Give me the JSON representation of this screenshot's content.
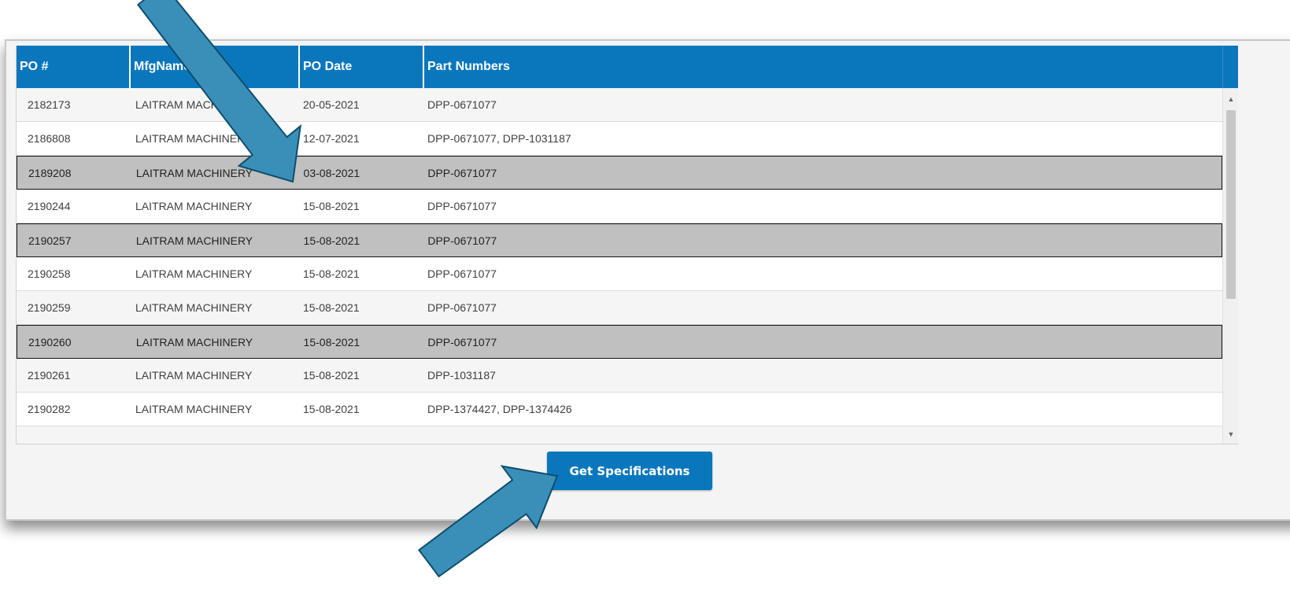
{
  "table": {
    "headers": [
      "PO #",
      "MfgName",
      "PO Date",
      "Part Numbers"
    ],
    "rows": [
      {
        "po": "2182173",
        "mfg": "LAITRAM MACHINERY",
        "date": "20-05-2021",
        "parts": "DPP-0671077",
        "selected": false
      },
      {
        "po": "2186808",
        "mfg": "LAITRAM MACHINERY",
        "date": "12-07-2021",
        "parts": "DPP-0671077, DPP-1031187",
        "selected": false
      },
      {
        "po": "2189208",
        "mfg": "LAITRAM MACHINERY",
        "date": "03-08-2021",
        "parts": "DPP-0671077",
        "selected": true
      },
      {
        "po": "2190244",
        "mfg": "LAITRAM MACHINERY",
        "date": "15-08-2021",
        "parts": "DPP-0671077",
        "selected": false
      },
      {
        "po": "2190257",
        "mfg": "LAITRAM MACHINERY",
        "date": "15-08-2021",
        "parts": "DPP-0671077",
        "selected": true
      },
      {
        "po": "2190258",
        "mfg": "LAITRAM MACHINERY",
        "date": "15-08-2021",
        "parts": "DPP-0671077",
        "selected": false
      },
      {
        "po": "2190259",
        "mfg": "LAITRAM MACHINERY",
        "date": "15-08-2021",
        "parts": "DPP-0671077",
        "selected": false
      },
      {
        "po": "2190260",
        "mfg": "LAITRAM MACHINERY",
        "date": "15-08-2021",
        "parts": "DPP-0671077",
        "selected": true
      },
      {
        "po": "2190261",
        "mfg": "LAITRAM MACHINERY",
        "date": "15-08-2021",
        "parts": "DPP-1031187",
        "selected": false
      },
      {
        "po": "2190282",
        "mfg": "LAITRAM MACHINERY",
        "date": "15-08-2021",
        "parts": "DPP-1374427, DPP-1374426",
        "selected": false
      }
    ]
  },
  "button": {
    "label": "Get Specifications"
  },
  "scroll": {
    "up_icon": "▲",
    "down_icon": "▼"
  },
  "colors": {
    "accent": "#0a77bd",
    "selected_row": "#c0c0c0",
    "annotation_arrow": "#3a8fb8"
  }
}
